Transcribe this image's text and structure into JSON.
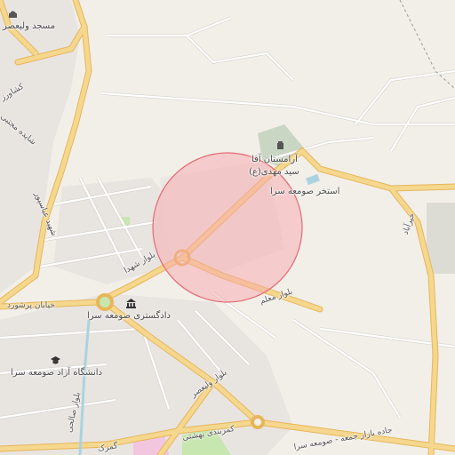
{
  "map": {
    "colors": {
      "background": "#f2efe9",
      "built_area": "#e8e4e0",
      "major_road": "#f5d78e",
      "major_road_casing": "#e7b65a",
      "minor_road": "#ffffff",
      "minor_road_casing": "#d6d2cc",
      "water": "#aad3df",
      "cemetery": "#c9d6c3",
      "park": "#c8e6b0",
      "highlight_fill": "#f7a8ad",
      "highlight_stroke": "#e56b75"
    },
    "labels": {
      "mosque": "مسجد ولیعصر",
      "keshavarz": "کشاورز",
      "shayedeh": "شایده مجتبی",
      "shahid_abbaspour": "شهید عباسپور",
      "cemetery_l1": "آرامستان آقا",
      "cemetery_l2": "سید مهدی(ع)",
      "pool": "استخر صومعه سرا",
      "blvd_shohada": "بلوار شهدا",
      "blvd_moallem": "بلوار معلم",
      "kheyrabad": "خیرآباد",
      "st_parshourd": "خیابان پرشورد",
      "court": "دادگستری صومعه سرا",
      "university": "دانشگاه آزاد صومعه سرا",
      "blvd_salehi": "بلوار صالحی",
      "blvd_valiasr": "بلوار ولیعصر",
      "kamarbandi": "کمربندی بهشتی",
      "bazar_jome": "جاده بازار جمعه - صومعه سرا",
      "gomrok": "گمرک"
    },
    "icons": {
      "mosque": "mosque-icon",
      "cemetery": "cemetery-icon",
      "court": "courthouse-icon",
      "university": "university-icon"
    }
  }
}
